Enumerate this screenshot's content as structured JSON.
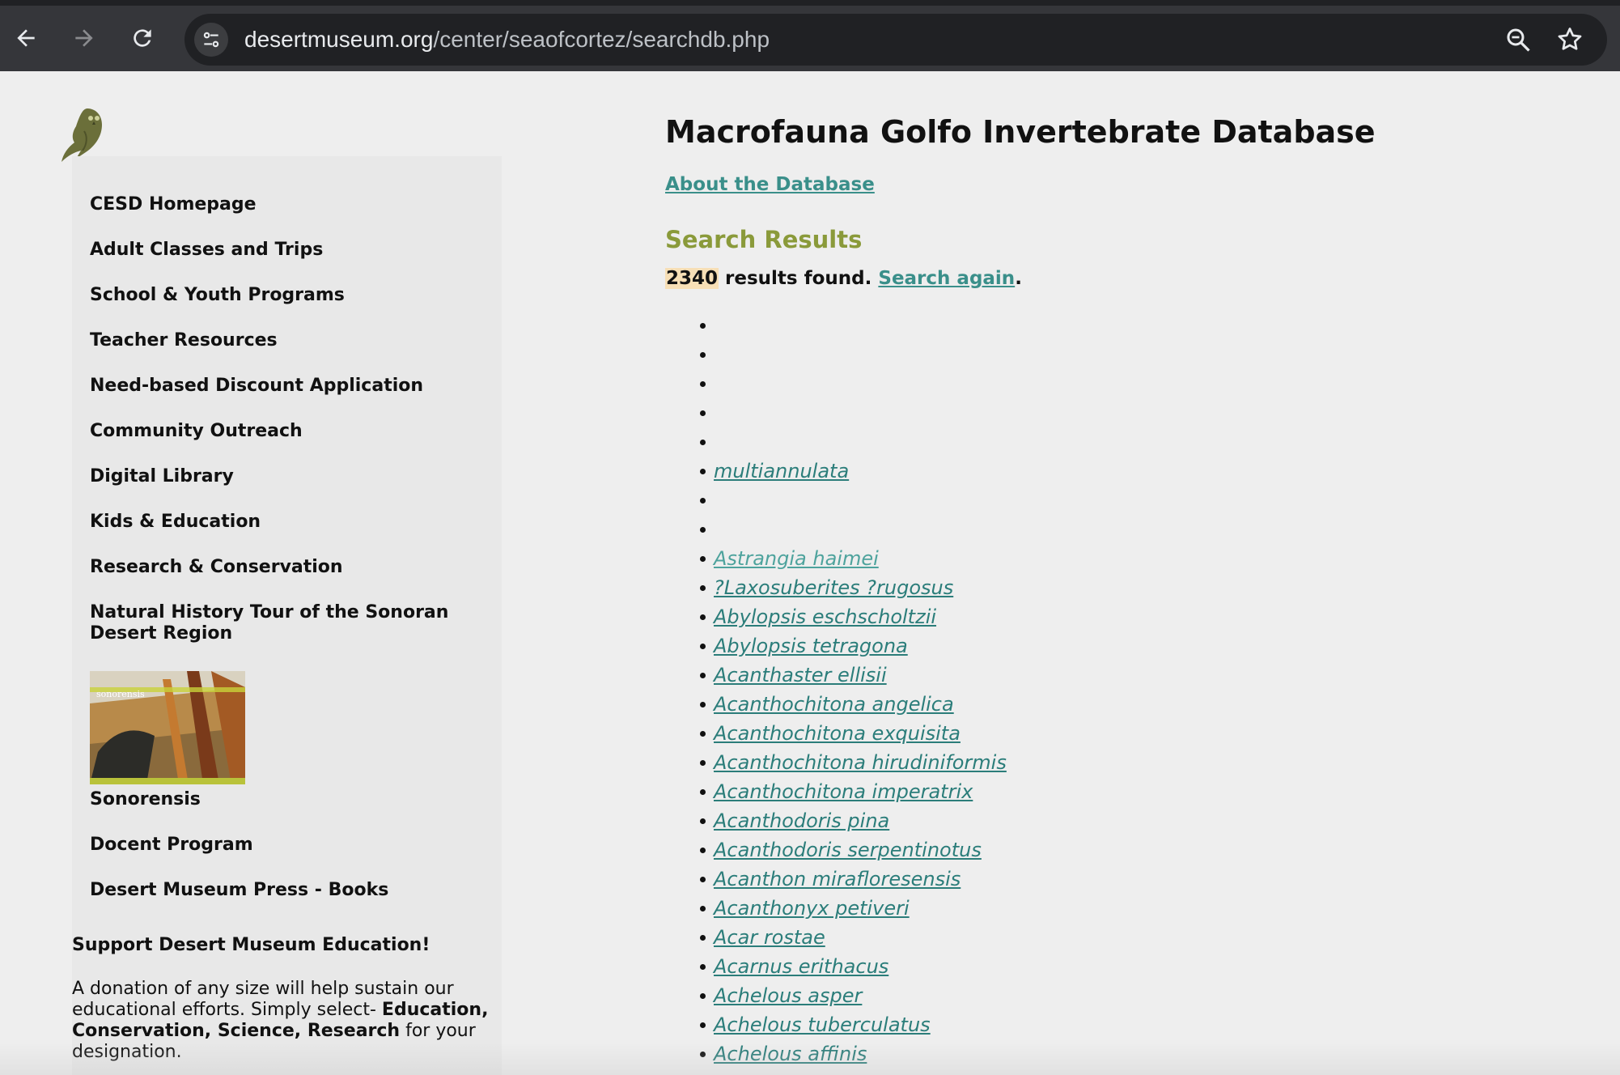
{
  "browser": {
    "url_host": "desertmuseum.org",
    "url_path": "/center/seaofcortez/searchdb.php"
  },
  "sidebar": {
    "items": [
      {
        "label": "CESD Homepage"
      },
      {
        "label": "Adult Classes and Trips"
      },
      {
        "label": "School & Youth Programs"
      },
      {
        "label": "Teacher Resources"
      },
      {
        "label": "Need-based Discount Application"
      },
      {
        "label": "Community Outreach"
      },
      {
        "label": "Digital Library"
      },
      {
        "label": "Kids & Education"
      },
      {
        "label": "Research & Conservation"
      },
      {
        "label": "Natural History Tour of the Sonoran Desert Region"
      },
      {
        "label": "Sonorensis"
      },
      {
        "label": "Docent Program"
      },
      {
        "label": "Desert Museum Press - Books"
      }
    ],
    "support_heading": "Support Desert Museum Education!",
    "support_text_1": "A donation of any size will help sustain our educational efforts. Simply select- ",
    "support_text_bold": "Education, Conservation, Science, Research",
    "support_text_2": " for your designation."
  },
  "main": {
    "title": "Macrofauna Golfo Invertebrate Database",
    "about_link": "About the Database",
    "results_heading": "Search Results",
    "result_count": "2340",
    "results_found_text": " results found. ",
    "search_again": "Search again",
    "period": "."
  },
  "results": [
    "",
    "",
    "",
    "",
    "",
    "multiannulata",
    "",
    "",
    "Astrangia haimei",
    "?Laxosuberites ?rugosus",
    "Abylopsis eschscholtzii",
    "Abylopsis tetragona",
    "Acanthaster ellisii",
    "Acanthochitona angelica",
    "Acanthochitona exquisita",
    "Acanthochitona hirudiniformis",
    "Acanthochitona imperatrix",
    "Acanthodoris pina",
    "Acanthodoris serpentinotus",
    "Acanthon mirafloresensis",
    "Acanthonyx petiveri",
    "Acar rostae",
    "Acarnus erithacus",
    "Achelous asper",
    "Achelous tuberculatus",
    "Achelous affinis"
  ],
  "colors": {
    "link": "#2b7d7a",
    "heading_green": "#8a9a3a",
    "count_highlight": "#f7dfb6"
  }
}
